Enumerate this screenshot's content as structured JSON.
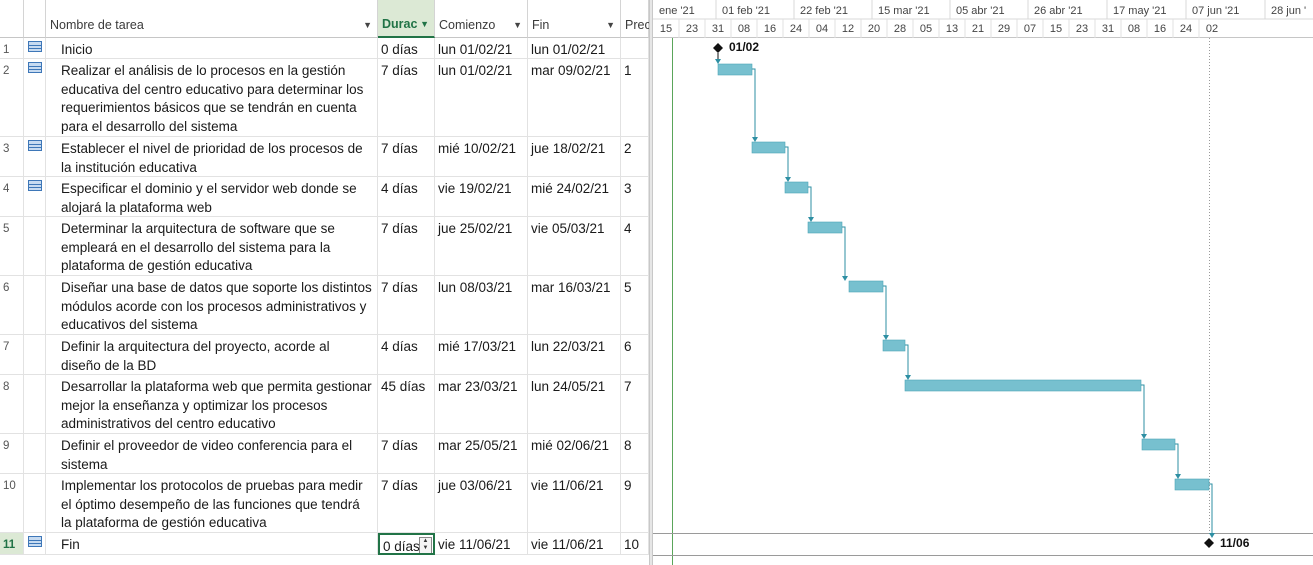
{
  "columns": {
    "info_glyph": "i",
    "name": "Nombre de tarea",
    "duration": "Durac",
    "start": "Comienzo",
    "finish": "Fin",
    "pred": "Prec"
  },
  "tasks": [
    {
      "id": "1",
      "name": "Inicio",
      "duration": "0 días",
      "start": "lun 01/02/21",
      "finish": "lun 01/02/21",
      "pred": "",
      "icon": "task-icon"
    },
    {
      "id": "2",
      "name": "Realizar el análisis de lo procesos en la gestión educativa del centro educativo para determinar los requerimientos básicos que se tendrán en cuenta para el desarrollo del sistema",
      "duration": "7 días",
      "start": "lun 01/02/21",
      "finish": "mar 09/02/21",
      "pred": "1",
      "icon": "task-icon"
    },
    {
      "id": "3",
      "name": "Establecer el nivel de prioridad de los procesos de la institución educativa",
      "duration": "7 días",
      "start": "mié 10/02/21",
      "finish": "jue 18/02/21",
      "pred": "2",
      "icon": "task-icon"
    },
    {
      "id": "4",
      "name": "Especificar el dominio y el servidor web donde se alojará la plataforma web",
      "duration": "4 días",
      "start": "vie 19/02/21",
      "finish": "mié 24/02/21",
      "pred": "3",
      "icon": "task-icon"
    },
    {
      "id": "5",
      "name": "Determinar la arquitectura de software que se empleará en el desarrollo del sistema para la plataforma de gestión educativa",
      "duration": "7 días",
      "start": "jue 25/02/21",
      "finish": "vie 05/03/21",
      "pred": "4",
      "icon": ""
    },
    {
      "id": "6",
      "name": "Diseñar una base de datos que soporte los distintos módulos acorde con los procesos administrativos y educativos del sistema",
      "duration": "7 días",
      "start": "lun 08/03/21",
      "finish": "mar 16/03/21",
      "pred": "5",
      "icon": ""
    },
    {
      "id": "7",
      "name": "Definir la arquitectura del proyecto, acorde al diseño de la BD",
      "duration": "4 días",
      "start": "mié 17/03/21",
      "finish": "lun 22/03/21",
      "pred": "6",
      "icon": ""
    },
    {
      "id": "8",
      "name": "Desarrollar la plataforma web que permita gestionar mejor la enseñanza y optimizar los procesos administrativos del centro educativo",
      "duration": "45 días",
      "start": "mar 23/03/21",
      "finish": "lun 24/05/21",
      "pred": "7",
      "icon": ""
    },
    {
      "id": "9",
      "name": "Definir el proveedor de video conferencia para el sistema",
      "duration": "7 días",
      "start": "mar 25/05/21",
      "finish": "mié 02/06/21",
      "pred": "8",
      "icon": ""
    },
    {
      "id": "10",
      "name": "Implementar los protocolos de pruebas para medir el óptimo desempeño de las funciones que tendrá la plataforma de gestión educativa",
      "duration": "7 días",
      "start": "jue 03/06/21",
      "finish": "vie 11/06/21",
      "pred": "9",
      "icon": ""
    },
    {
      "id": "11",
      "name": "Fin",
      "duration": "0 días",
      "start": "vie 11/06/21",
      "finish": "vie 11/06/21",
      "pred": "10",
      "icon": "task-icon"
    }
  ],
  "timescale": {
    "major": [
      "ene '21",
      "01 feb '21",
      "22 feb '21",
      "15 mar '21",
      "05 abr '21",
      "26 abr '21",
      "17 may '21",
      "07 jun '21",
      "28 jun '"
    ],
    "minor": [
      "15",
      "23",
      "31",
      "08",
      "16",
      "24",
      "04",
      "12",
      "20",
      "28",
      "05",
      "13",
      "21",
      "29",
      "07",
      "15",
      "23",
      "31",
      "08",
      "16",
      "24",
      "02"
    ]
  },
  "milestones": {
    "start_label": "01/02",
    "end_label": "11/06"
  },
  "colors": {
    "bar": "#77c0cf",
    "bar_border": "#4ea5b6",
    "link": "#2e8fa3",
    "selection": "#217346",
    "header_active": "#dce9d5"
  }
}
